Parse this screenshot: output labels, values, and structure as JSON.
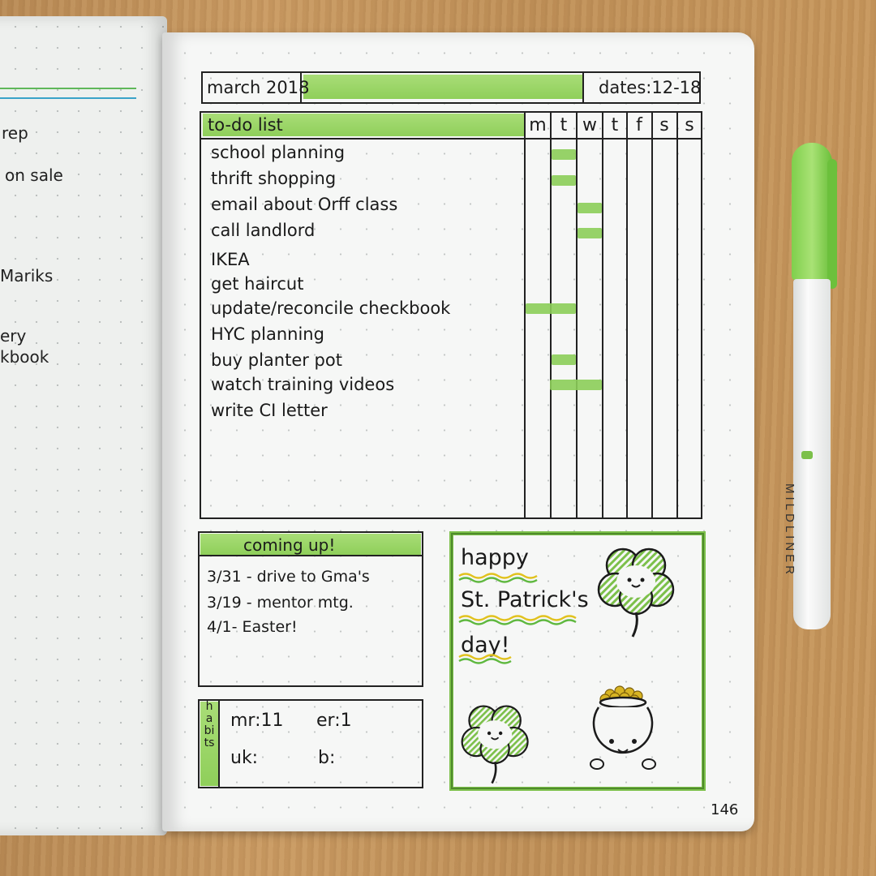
{
  "header": {
    "month": "march 2018",
    "dates": "dates:12-18"
  },
  "todo": {
    "title": "to-do list",
    "days": [
      "m",
      "t",
      "w",
      "t",
      "f",
      "s",
      "s"
    ],
    "items": [
      "school planning",
      "thrift shopping",
      "email about Orff class",
      "call landlord",
      "IKEA",
      "get haircut",
      "update/reconcile checkbook",
      "HYC planning",
      "buy planter pot",
      "watch training videos",
      "write CI letter"
    ]
  },
  "coming_up": {
    "title": "coming up!",
    "events": [
      "3/31 - drive to Gma's",
      "3/19 - mentor mtg.",
      "4/1- Easter!"
    ]
  },
  "habits": {
    "label": "habits",
    "entries": [
      "mr:11",
      "er:1",
      "uk:",
      "b:"
    ]
  },
  "greeting": {
    "line1": "happy",
    "line2": "St. Patrick's",
    "line3": "day!"
  },
  "left_page": {
    "fragments": [
      "rep",
      "on sale",
      "Mariks",
      "ery",
      "kbook"
    ]
  },
  "page_number": "146",
  "pen": {
    "brand": "MILDLINER"
  },
  "colors": {
    "accent_green": "#8fcf5a",
    "ink": "#1b1b1b",
    "paper": "#f6f7f6",
    "wood": "#c6965c"
  }
}
